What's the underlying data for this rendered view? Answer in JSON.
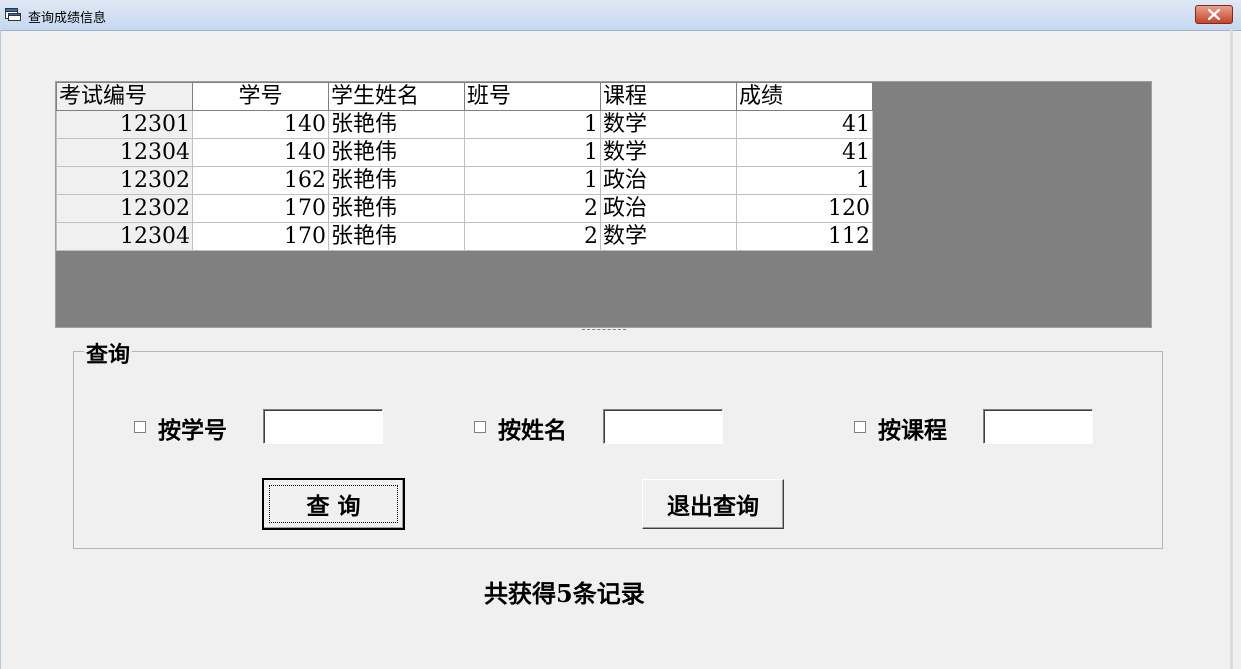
{
  "window": {
    "title": "查询成绩信息",
    "app_icon": "form-icon",
    "close_icon": "close-x-icon"
  },
  "grid": {
    "columns": [
      "考试编号",
      "学号",
      "学生姓名",
      "班号",
      "课程",
      "成绩"
    ],
    "rows": [
      [
        "12301",
        "140",
        "张艳伟",
        "1",
        "数学",
        "41"
      ],
      [
        "12304",
        "140",
        "张艳伟",
        "1",
        "数学",
        "41"
      ],
      [
        "12302",
        "162",
        "张艳伟",
        "1",
        "政治",
        "1"
      ],
      [
        "12302",
        "170",
        "张艳伟",
        "2",
        "政治",
        "120"
      ],
      [
        "12304",
        "170",
        "张艳伟",
        "2",
        "数学",
        "112"
      ]
    ]
  },
  "query_frame": {
    "label": "查询",
    "by_student_id": {
      "label": "按学号",
      "checked": false,
      "value": ""
    },
    "by_name": {
      "label": "按姓名",
      "checked": false,
      "value": ""
    },
    "by_course": {
      "label": "按课程",
      "checked": false,
      "value": ""
    },
    "query_button": "查 询",
    "exit_button": "退出查询"
  },
  "status": {
    "text": "共获得5条记录"
  },
  "colors": {
    "grid_background": "#808080",
    "window_background": "#f0f0f0",
    "close_button": "#c5442b"
  }
}
